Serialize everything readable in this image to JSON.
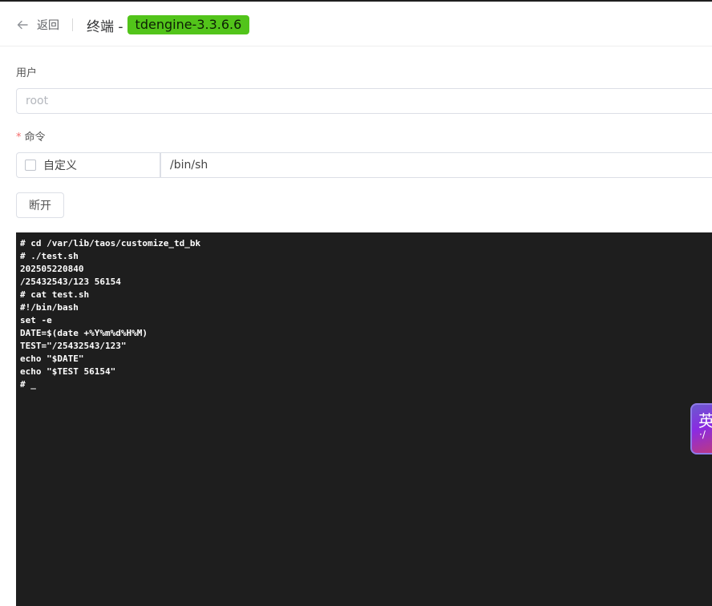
{
  "header": {
    "back_label": "返回",
    "title": "终端 -",
    "version_tag": "tdengine-3.3.6.6"
  },
  "form": {
    "user": {
      "label": "用户",
      "placeholder": "root"
    },
    "command": {
      "required_mark": "*",
      "label": "命令",
      "custom_checkbox_label": "自定义",
      "custom_checked": false,
      "value": "/bin/sh"
    },
    "disconnect_button": "断开"
  },
  "terminal": {
    "lines": [
      "# cd /var/lib/taos/customize_td_bk",
      "# ./test.sh",
      "202505220840",
      "/25432543/123 56154",
      "# cat test.sh",
      "#!/bin/bash",
      "set -e",
      "DATE=$(date +%Y%m%d%H%M)",
      "TEST=\"/25432543/123\"",
      "echo \"$DATE\"",
      "echo \"$TEST 56154\"",
      "# _"
    ]
  },
  "ime": {
    "char": "英",
    "deco": "·/"
  },
  "colors": {
    "tag_green": "#52c41a",
    "terminal_bg": "#1e1e1e",
    "required_red": "#f56c6c"
  }
}
